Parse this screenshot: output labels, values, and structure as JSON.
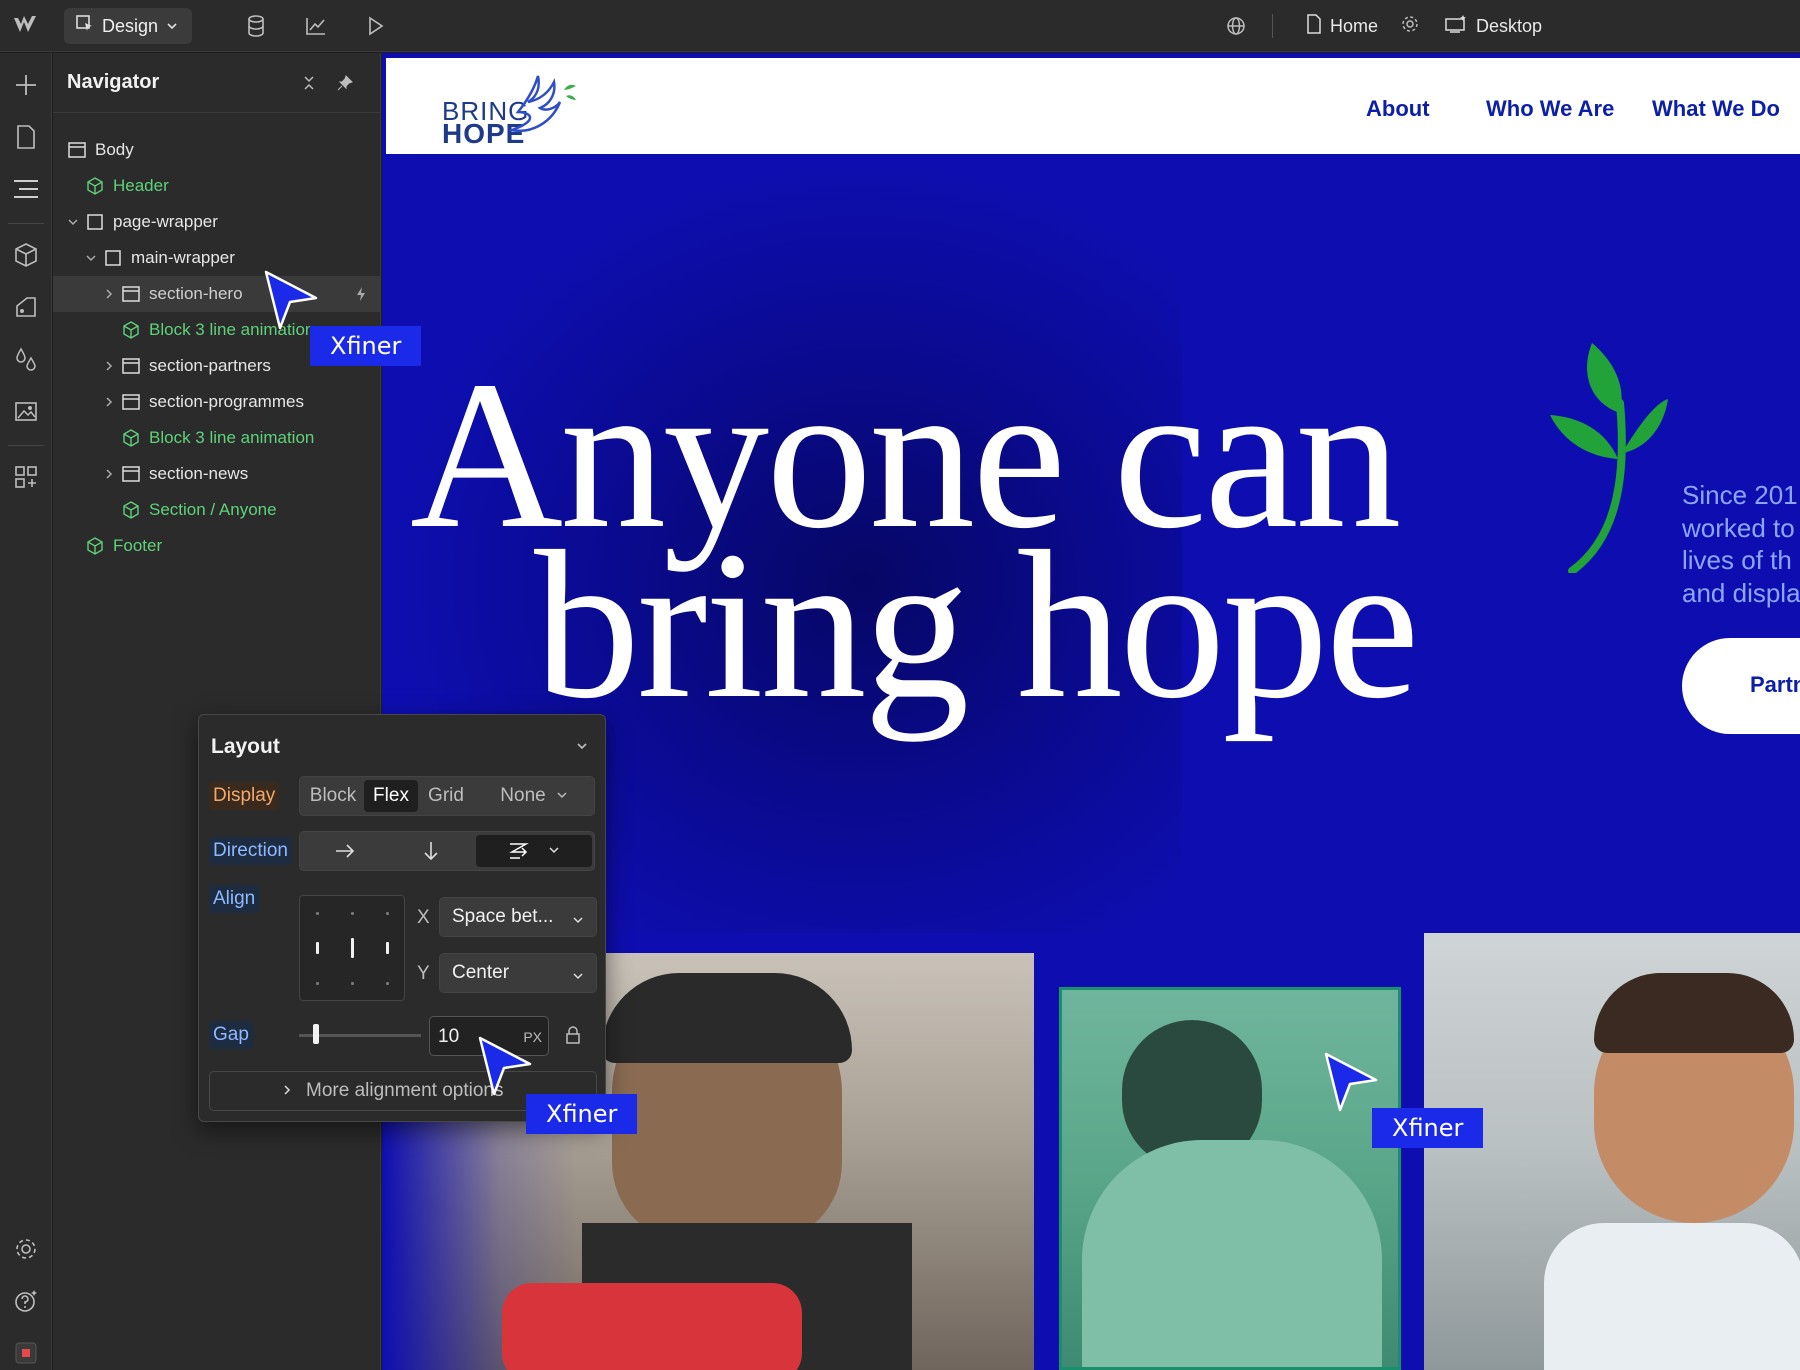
{
  "topbar": {
    "mode_label": "Design",
    "page_label": "Home",
    "breakpoint_label": "Desktop"
  },
  "navigator": {
    "title": "Navigator",
    "items": [
      {
        "label": "Body",
        "kind": "element",
        "color": "white"
      },
      {
        "label": "Header",
        "kind": "component",
        "color": "green"
      },
      {
        "label": "page-wrapper",
        "kind": "element",
        "color": "white"
      },
      {
        "label": "main-wrapper",
        "kind": "element",
        "color": "white"
      },
      {
        "label": "section-hero",
        "kind": "section",
        "color": "white",
        "selected": true
      },
      {
        "label": "Block 3 line animation",
        "kind": "component",
        "color": "green"
      },
      {
        "label": "section-partners",
        "kind": "section",
        "color": "white"
      },
      {
        "label": "section-programmes",
        "kind": "section",
        "color": "white"
      },
      {
        "label": "Block 3 line animation",
        "kind": "component",
        "color": "green"
      },
      {
        "label": "section-news",
        "kind": "section",
        "color": "white"
      },
      {
        "label": "Section / Anyone",
        "kind": "component",
        "color": "green"
      },
      {
        "label": "Footer",
        "kind": "component",
        "color": "green"
      }
    ]
  },
  "site": {
    "logo_bring": "BRING",
    "logo_hope": "HOPE",
    "nav": [
      "About",
      "Who We Are",
      "What We Do"
    ],
    "hero_line1": "Anyone can",
    "hero_line2": "bring hope",
    "side_text_lines": [
      "Since 201",
      "worked to",
      "lives of th",
      "and displa"
    ],
    "partner_button": "Partn"
  },
  "layout_panel": {
    "title": "Layout",
    "display_label": "Display",
    "display_options": [
      "Block",
      "Flex",
      "Grid",
      "None"
    ],
    "display_selected": "Flex",
    "direction_label": "Direction",
    "align_label": "Align",
    "x_label": "X",
    "y_label": "Y",
    "x_value": "Space bet...",
    "y_value": "Center",
    "gap_label": "Gap",
    "gap_value": "10",
    "gap_unit": "PX",
    "more_label": "More alignment options"
  },
  "cursors": [
    "Xfiner",
    "Xfiner",
    "Xfiner"
  ],
  "colors": {
    "canvas_blue": "#0e0eb0",
    "nav_blue": "#0b1fa8",
    "component_green": "#5fd17a",
    "cursor_blue": "#1a2ae8"
  }
}
